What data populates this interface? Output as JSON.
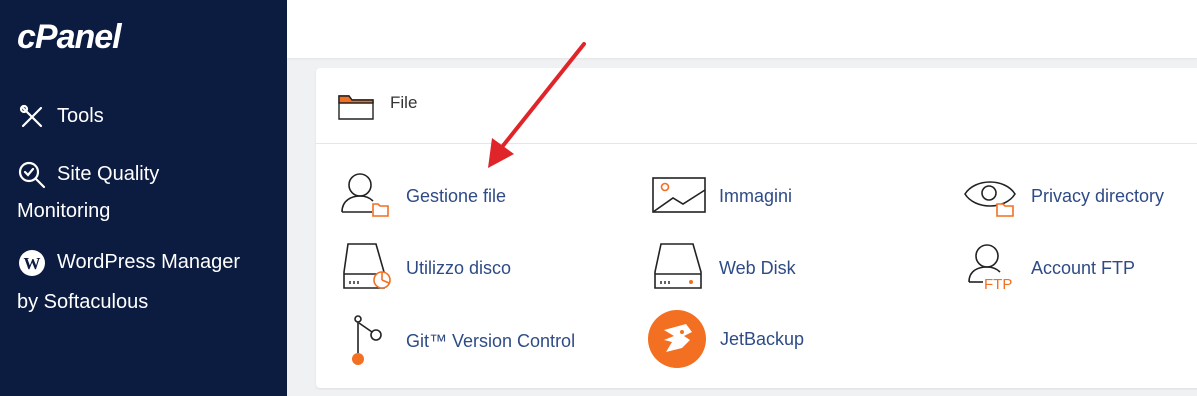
{
  "sidebar": {
    "logo": "cPanel",
    "items": [
      {
        "label": "Tools"
      },
      {
        "label": "Site Quality",
        "label2": "Monitoring"
      },
      {
        "label": "WordPress Manager",
        "label2": "by Softaculous"
      }
    ]
  },
  "section": {
    "title": "File",
    "items": [
      {
        "label": "Gestione file",
        "icon": "file-manager-icon"
      },
      {
        "label": "Immagini",
        "icon": "images-icon"
      },
      {
        "label": "Privacy directory",
        "icon": "directory-privacy-icon"
      },
      {
        "label": "Utilizzo disco",
        "icon": "disk-usage-icon"
      },
      {
        "label": "Web Disk",
        "icon": "web-disk-icon"
      },
      {
        "label": "Account FTP",
        "icon": "ftp-accounts-icon"
      },
      {
        "label": "Git™ Version Control",
        "icon": "git-icon"
      },
      {
        "label": "JetBackup",
        "icon": "jetbackup-icon"
      }
    ]
  },
  "colors": {
    "sidebar": "#0c1b40",
    "accent": "#f36f21",
    "link": "#2e4b86",
    "annotation_arrow": "#e0252a"
  }
}
